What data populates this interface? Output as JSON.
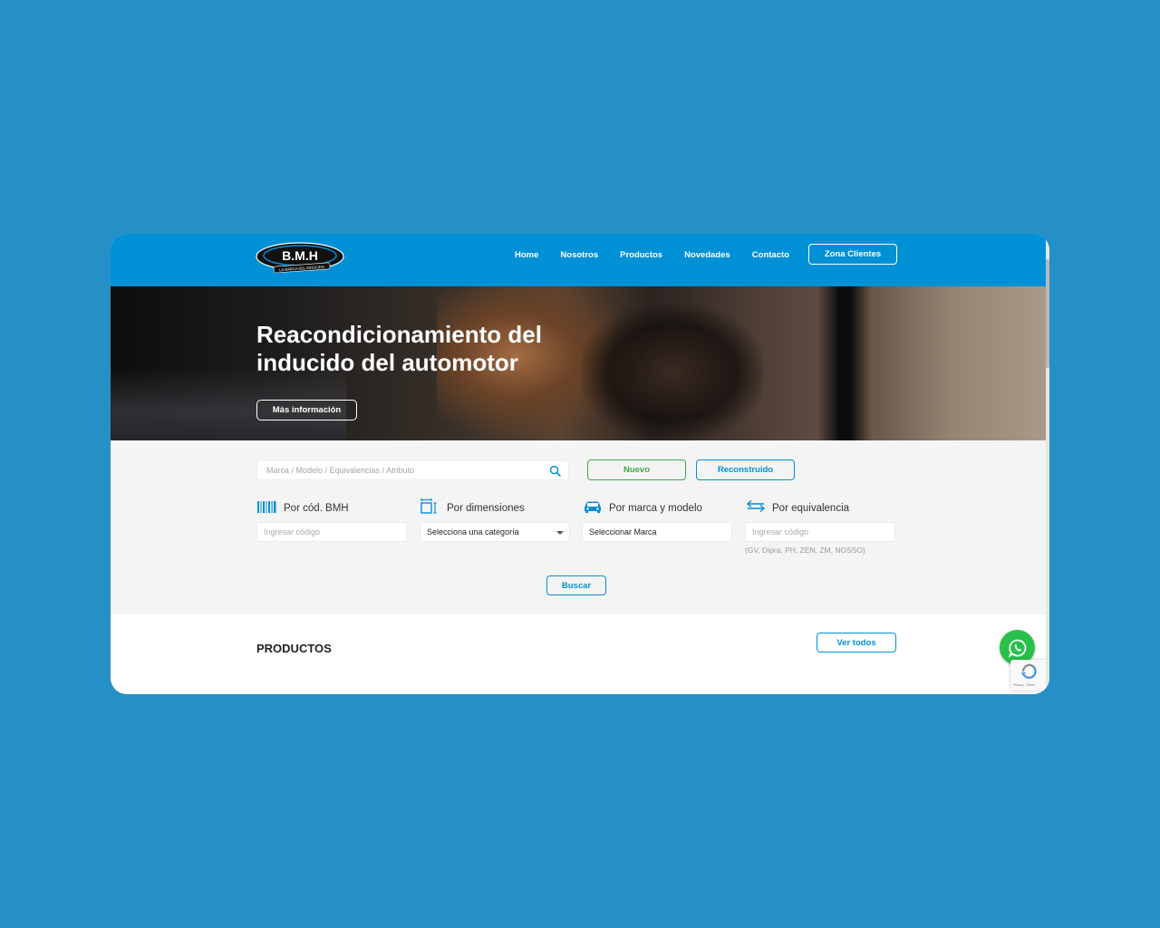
{
  "header": {
    "logo_text": "B.M.H",
    "logo_tagline": "LA MARCA DEL INDUCIDO",
    "nav": [
      "Home",
      "Nosotros",
      "Productos",
      "Novedades",
      "Contacto"
    ],
    "cta": "Zona Clientes"
  },
  "hero": {
    "title": "Reacondicionamiento del inducido del automotor",
    "button": "Más información"
  },
  "search": {
    "placeholder": "Marca / Modelo / Equivalencias / Atributo",
    "btn_nuevo": "Nuevo",
    "btn_reconstruido": "Reconstruido",
    "filters": [
      {
        "label": "Por cód. BMH",
        "icon": "barcode-icon",
        "value": "Ingresar código"
      },
      {
        "label": "Por dimensiones",
        "icon": "dimensions-icon",
        "value": "Selecciona una categoría"
      },
      {
        "label": "Por marca y modelo",
        "icon": "car-icon",
        "value": "Seleccionar Marca"
      },
      {
        "label": "Por equivalencia",
        "icon": "arrows-icon",
        "value": "Ingresar código",
        "note": "(GV, Dipra, PH, ZEN, ZM, NOSSO)"
      }
    ],
    "submit": "Buscar"
  },
  "productos": {
    "title": "PRODUCTOS",
    "ver_todos": "Ver todos"
  },
  "recaptcha": {
    "text": "Privacy - Terms"
  },
  "colors": {
    "brand": "#0090d6",
    "green": "#3ea64b",
    "whatsapp": "#27c14a",
    "background": "#2590c6"
  }
}
